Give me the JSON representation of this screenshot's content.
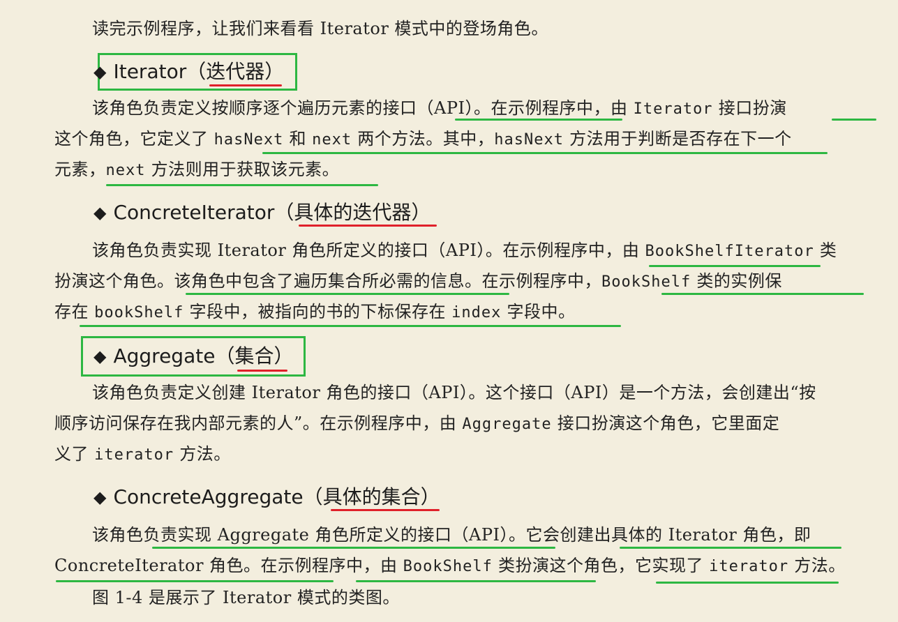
{
  "intro": "读完示例程序，让我们来看看 Iterator 模式中的登场角色。",
  "sections": [
    {
      "heading": {
        "name": "Iterator",
        "open": "（",
        "label": "迭代器",
        "close": "）"
      },
      "lines": [
        {
          "a": "该角色负责定义按顺序逐个遍历元素的接口（API）。在示例程序中，由 ",
          "code": "Iterator",
          "b": " 接口扮演"
        },
        {
          "a": "这个角色，它定义了 ",
          "code": "hasNext",
          "b": " 和 ",
          "code2": "next",
          "c": " 两个方法。其中，",
          "code3": "hasNext",
          "d": " 方法用于判断是否存在下一个"
        },
        {
          "a": "元素，",
          "code": "next",
          "b": " 方法则用于获取该元素。"
        }
      ]
    },
    {
      "heading": {
        "name": "ConcreteIterator",
        "open": "（",
        "label": "具体的迭代器",
        "close": "）"
      },
      "lines": [
        {
          "a": "该角色负责实现 Iterator 角色所定义的接口（API）。在示例程序中，由 ",
          "code": "BookShelfIterator",
          "b": " 类"
        },
        {
          "a": "扮演这个角色。该角色中包含了遍历集合所必需的信息。在示例程序中，",
          "code": "BookShelf",
          "b": " 类的实例保"
        },
        {
          "a": "存在 ",
          "code": "bookShelf",
          "b": " 字段中，被指向的书的下标保存在 ",
          "code2": "index",
          "c": " 字段中。"
        }
      ]
    },
    {
      "heading": {
        "name": "Aggregate",
        "open": "（",
        "label": "集合",
        "close": "）"
      },
      "lines": [
        {
          "a": "该角色负责定义创建 Iterator 角色的接口（API）。这个接口（API）是一个方法，会创建出“按"
        },
        {
          "a": "顺序访问保存在我内部元素的人”。在示例程序中，由 ",
          "code": "Aggregate",
          "b": " 接口扮演这个角色，它里面定"
        },
        {
          "a": "义了 ",
          "code": "iterator",
          "b": " 方法。"
        }
      ]
    },
    {
      "heading": {
        "name": "ConcreteAggregate",
        "open": "（",
        "label": "具体的集合",
        "close": "）"
      },
      "lines": [
        {
          "a": "该角色负责实现 Aggregate 角色所定义的接口（API）。它会创建出具体的 Iterator 角色，即"
        },
        {
          "a": "ConcreteIterator 角色。在示例程序中，由 ",
          "code": "BookShelf",
          "b": " 类扮演这个角色，它实现了 ",
          "code2": "iterator",
          "c": " 方法。"
        }
      ]
    }
  ],
  "outro": "图 1-4 是展示了 Iterator 模式的类图。",
  "colors": {
    "background": "#f3eede",
    "green_annotation": "#2db742",
    "red_annotation": "#e0202a"
  }
}
